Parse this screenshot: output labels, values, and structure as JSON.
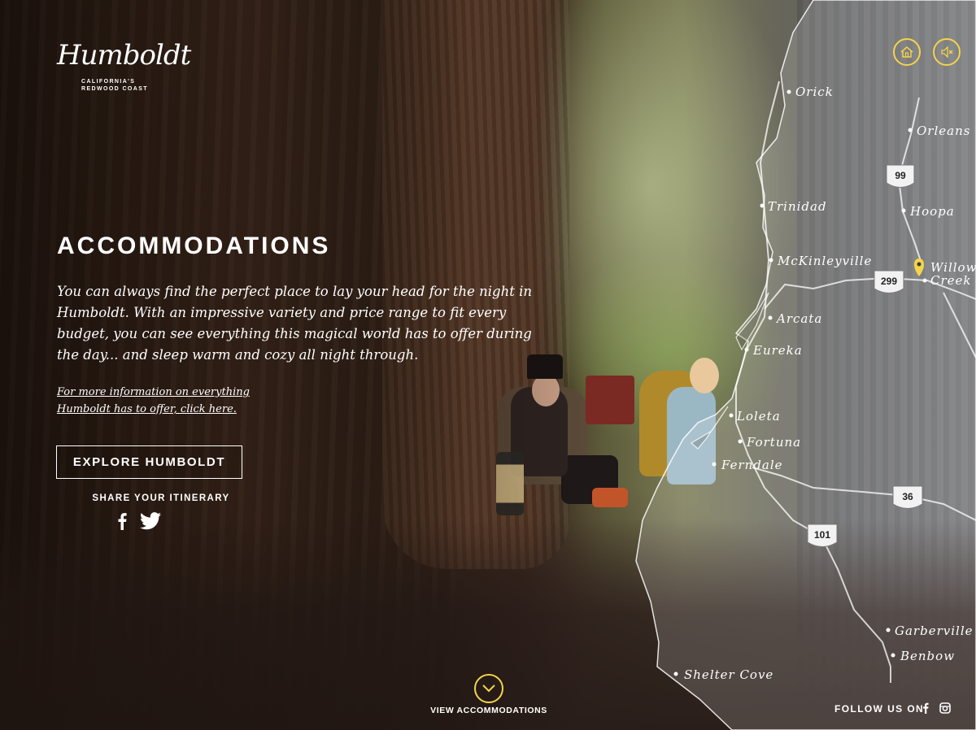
{
  "brand": {
    "logo_script": "Humboldt",
    "logo_line1": "CALIFORNIA'S",
    "logo_line2": "REDWOOD COAST"
  },
  "header": {
    "home_icon": "home-icon",
    "mute_icon": "mute-icon"
  },
  "content": {
    "title": "ACCOMMODATIONS",
    "description": "You can always find the perfect place to lay your head for the night in Humboldt. With an impressive variety and price range to fit every budget, you can see everything this magical world has to offer during the day... and sleep warm and cozy all night through.",
    "more_link": "For more information on everything Humboldt has to offer, click here.",
    "explore_button": "EXPLORE HUMBOLDT",
    "share_label": "SHARE YOUR ITINERARY"
  },
  "map": {
    "towns": {
      "orick": "Orick",
      "orleans": "Orleans",
      "trinidad": "Trinidad",
      "hoopa": "Hoopa",
      "mckinleyville": "McKinleyville",
      "willow_creek_1": "Willow",
      "willow_creek_2": "Creek",
      "arcata": "Arcata",
      "eureka": "Eureka",
      "loleta": "Loleta",
      "fortuna": "Fortuna",
      "ferndale": "Ferndale",
      "garberville": "Garberville",
      "benbow": "Benbow",
      "shelter_cove": "Shelter Cove"
    },
    "highways": {
      "h99": "99",
      "h299": "299",
      "h36": "36",
      "h101": "101"
    },
    "pin_color": "#f4d44a"
  },
  "footer": {
    "view_label": "VIEW ACCOMMODATIONS",
    "follow_label": "FOLLOW US ON"
  },
  "colors": {
    "accent": "#f4d44a",
    "text": "#ffffff"
  }
}
